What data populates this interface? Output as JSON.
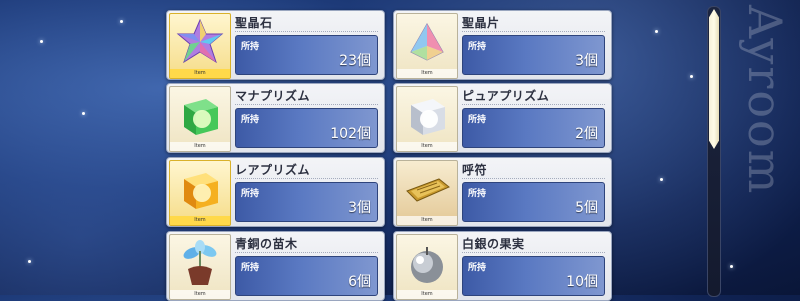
{
  "background": {
    "watermark": "Ayroom"
  },
  "items": [
    {
      "name": "聖晶石",
      "count_label": "所持",
      "count": "23個",
      "icon": "saint-quartz-icon",
      "tag": "Item"
    },
    {
      "name": "聖晶片",
      "count_label": "所持",
      "count": "3個",
      "icon": "saint-quartz-fragment-icon",
      "tag": "Item"
    },
    {
      "name": "マナプリズム",
      "count_label": "所持",
      "count": "102個",
      "icon": "mana-prism-icon",
      "tag": "Item"
    },
    {
      "name": "ピュアプリズム",
      "count_label": "所持",
      "count": "2個",
      "icon": "pure-prism-icon",
      "tag": "Item"
    },
    {
      "name": "レアプリズム",
      "count_label": "所持",
      "count": "3個",
      "icon": "rare-prism-icon",
      "tag": "Item"
    },
    {
      "name": "呼符",
      "count_label": "所持",
      "count": "5個",
      "icon": "summon-ticket-icon",
      "tag": "Item"
    },
    {
      "name": "青銅の苗木",
      "count_label": "所持",
      "count": "6個",
      "icon": "bronze-sapling-icon",
      "tag": "Item"
    },
    {
      "name": "白銀の果実",
      "count_label": "所持",
      "count": "10個",
      "icon": "silver-fruit-icon",
      "tag": "Item"
    }
  ],
  "scrollbar": {
    "position": 0,
    "visible_fraction": 0.48
  }
}
